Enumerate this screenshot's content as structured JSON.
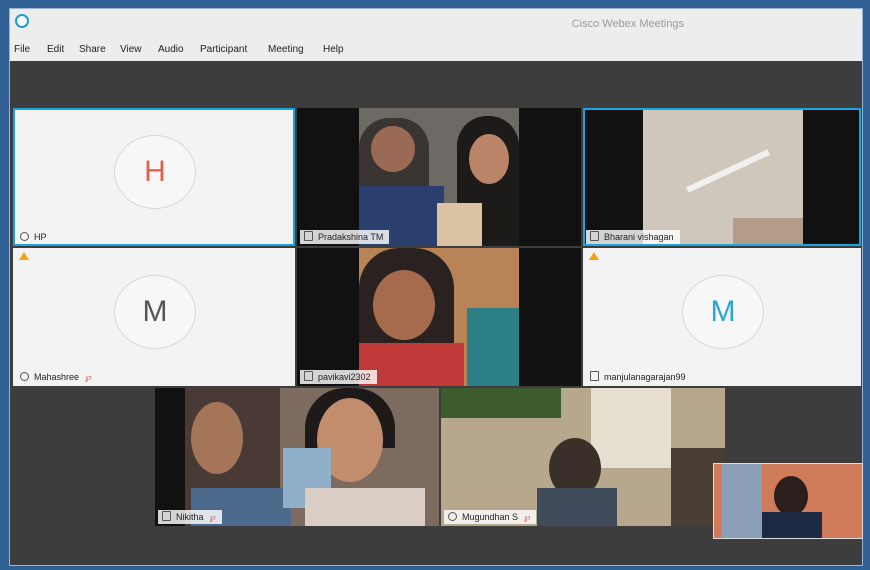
{
  "window": {
    "title": "Cisco Webex Meetings"
  },
  "menu": [
    "File",
    "Edit",
    "Share",
    "View",
    "Audio",
    "Participant",
    "Meeting",
    "Help"
  ],
  "participants": [
    {
      "name": "HP",
      "initial": "H"
    },
    {
      "name": "Pradakshina TM"
    },
    {
      "name": "Bharani vishagan"
    },
    {
      "name": "Mahashree",
      "initial": "M"
    },
    {
      "name": "pavikavi2302"
    },
    {
      "name": "manjulanagarajan99",
      "initial": "M"
    },
    {
      "name": "Nikitha"
    },
    {
      "name": "Mugundhan S"
    }
  ],
  "colors": {
    "accent": "#1aa4e0",
    "initial_red": "#e0624f",
    "initial_blue": "#2aa6d8",
    "warning": "#f0a21a"
  }
}
